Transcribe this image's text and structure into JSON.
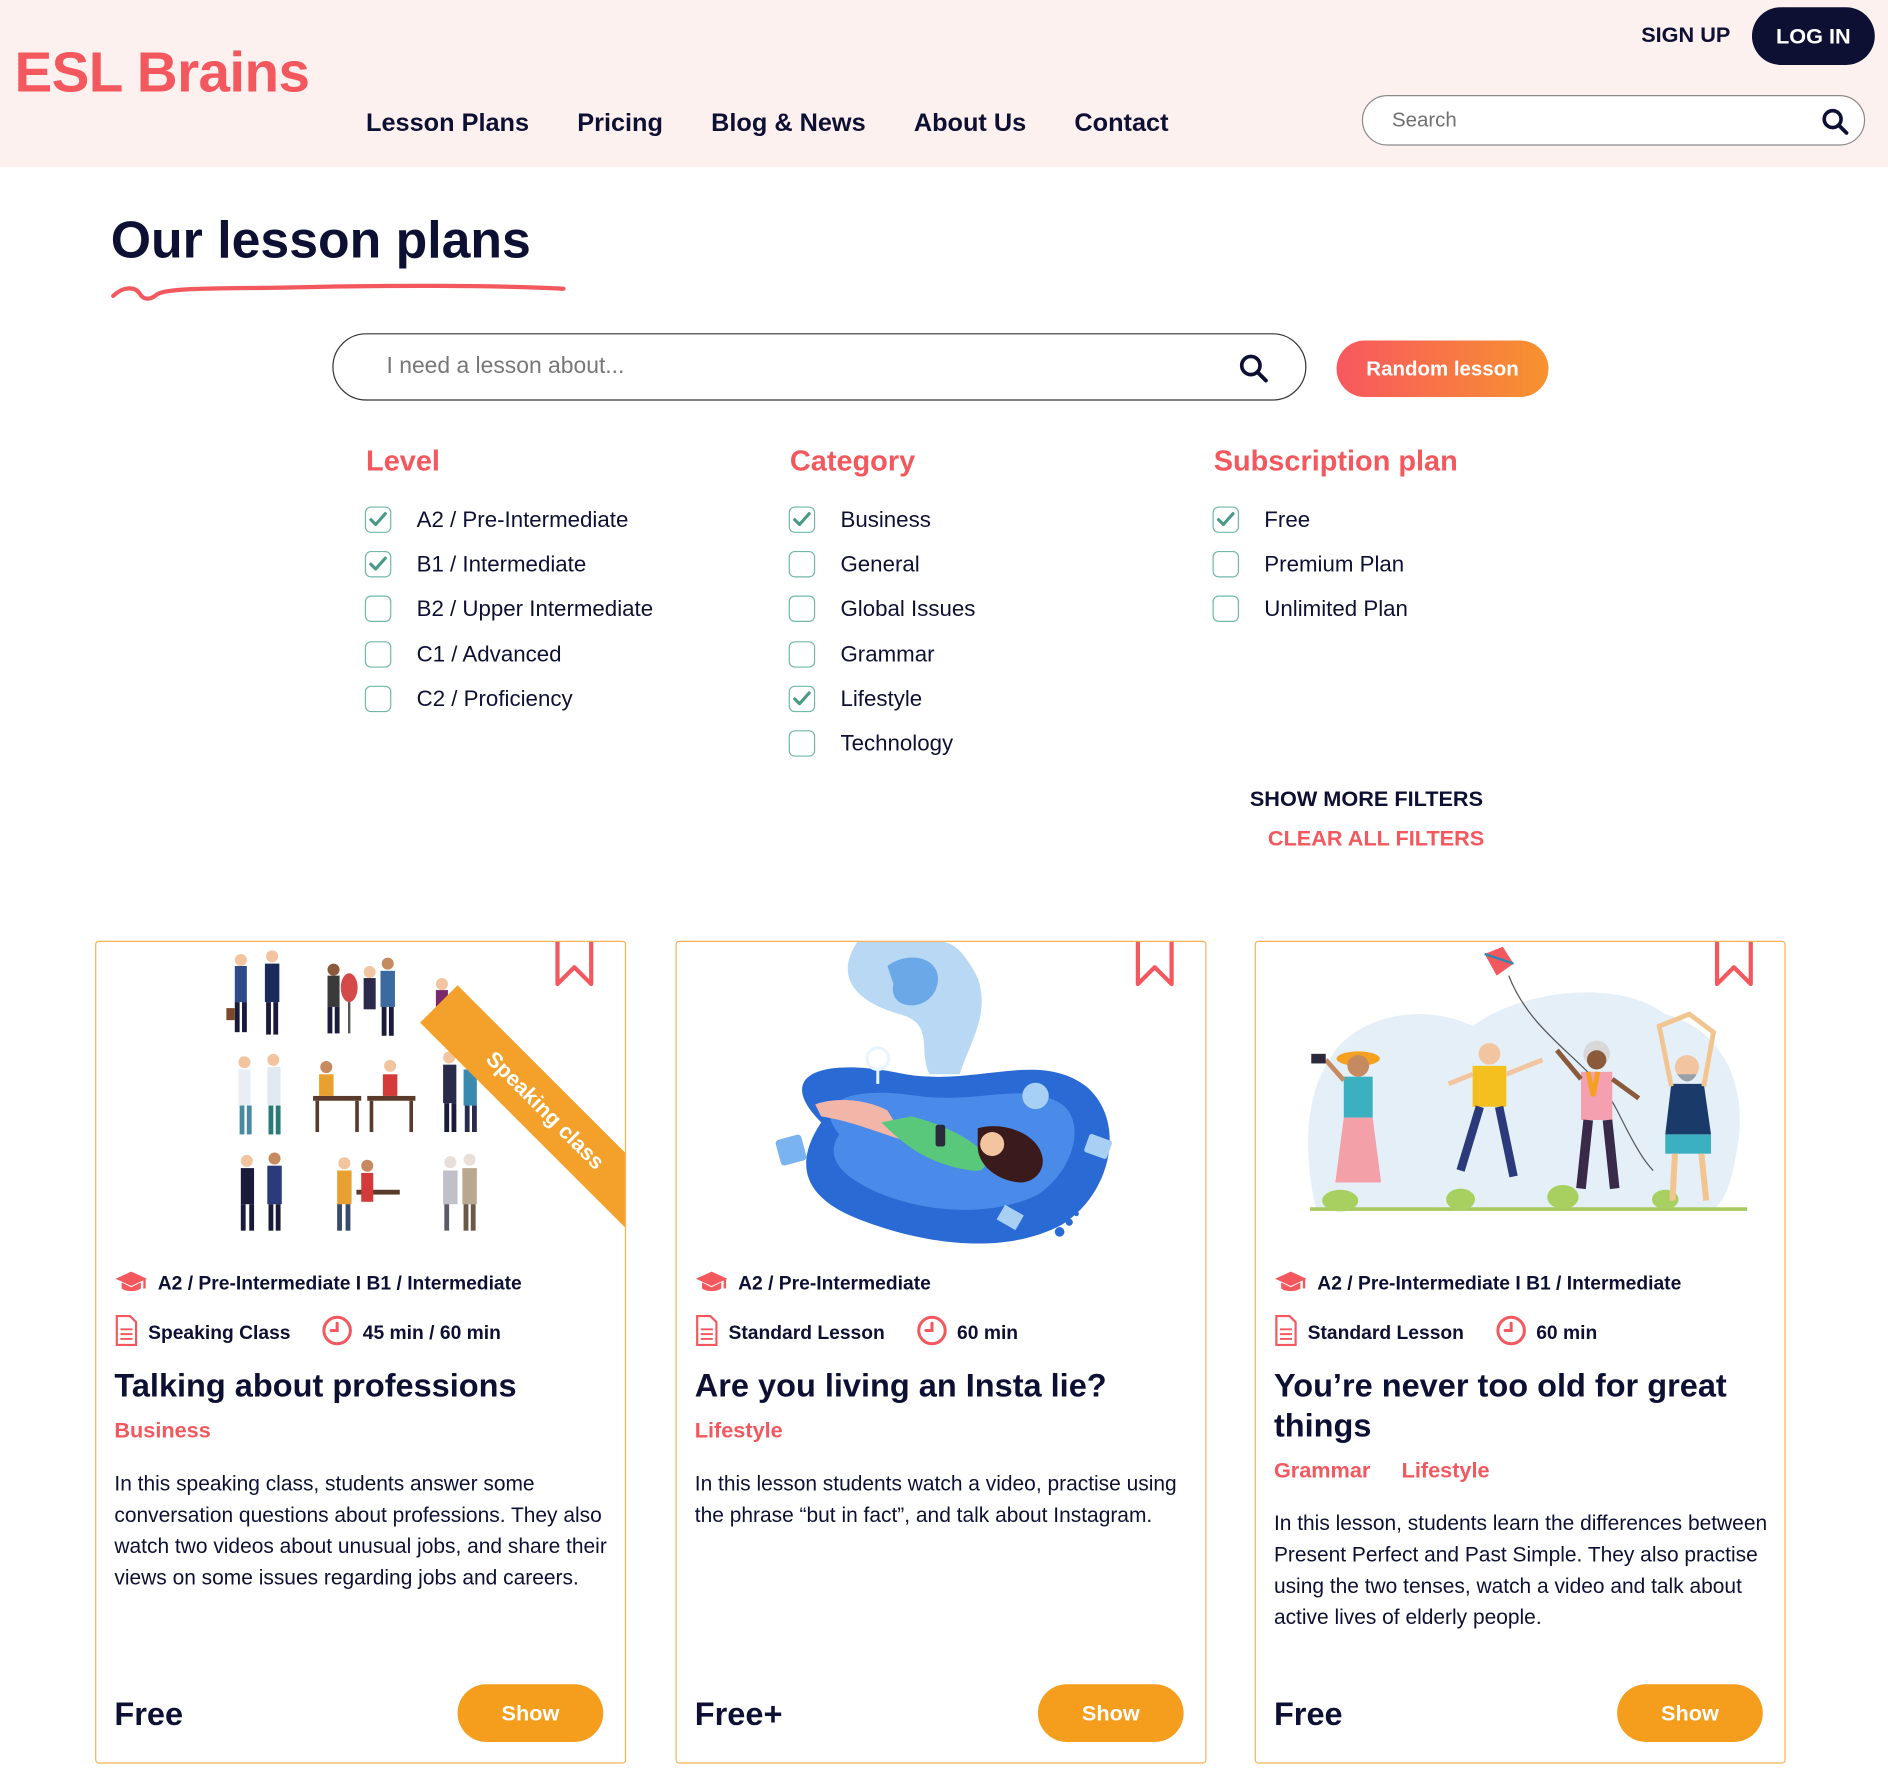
{
  "header": {
    "logo": "ESL Brains",
    "nav": [
      "Lesson Plans",
      "Pricing",
      "Blog & News",
      "About Us",
      "Contact"
    ],
    "sign_up": "SIGN UP",
    "log_in": "LOG IN",
    "search_placeholder": "Search"
  },
  "page": {
    "title": "Our lesson plans",
    "search_placeholder": "I need a lesson about...",
    "random_label": "Random lesson"
  },
  "filters": {
    "level": {
      "heading": "Level",
      "options": [
        {
          "label": "A2 / Pre-Intermediate",
          "checked": true
        },
        {
          "label": "B1 / Intermediate",
          "checked": true
        },
        {
          "label": "B2 / Upper Intermediate",
          "checked": false
        },
        {
          "label": "C1 / Advanced",
          "checked": false
        },
        {
          "label": "C2 / Proficiency",
          "checked": false
        }
      ]
    },
    "category": {
      "heading": "Category",
      "options": [
        {
          "label": "Business",
          "checked": true
        },
        {
          "label": "General",
          "checked": false
        },
        {
          "label": "Global Issues",
          "checked": false
        },
        {
          "label": "Grammar",
          "checked": false
        },
        {
          "label": "Lifestyle",
          "checked": true
        },
        {
          "label": "Technology",
          "checked": false
        }
      ]
    },
    "plan": {
      "heading": "Subscription plan",
      "options": [
        {
          "label": "Free",
          "checked": true
        },
        {
          "label": "Premium Plan",
          "checked": false
        },
        {
          "label": "Unlimited Plan",
          "checked": false
        }
      ]
    },
    "show_more": "SHOW MORE FILTERS",
    "clear_all": "CLEAR ALL FILTERS"
  },
  "cards": [
    {
      "ribbon": "Speaking class",
      "levels": "A2 / Pre-Intermediate I B1 / Intermediate",
      "type": "Speaking Class",
      "duration": "45 min / 60 min",
      "title": "Talking about professions",
      "categories": [
        "Business"
      ],
      "description": "In this speaking class, students answer some conversation questions about professions. They also watch two videos about unusual jobs, and share their views on some issues regarding jobs and careers.",
      "price": "Free",
      "button": "Show"
    },
    {
      "levels": "A2 / Pre-Intermediate",
      "type": "Standard Lesson",
      "duration": "60 min",
      "title": "Are you living an Insta lie?",
      "categories": [
        "Lifestyle"
      ],
      "description": "In this lesson students watch a video, practise using the phrase “but in fact”, and talk about Instagram.",
      "price": "Free+",
      "button": "Show"
    },
    {
      "levels": "A2 / Pre-Intermediate I B1 / Intermediate",
      "type": "Standard Lesson",
      "duration": "60 min",
      "title": "You’re never too old for great things",
      "categories": [
        "Grammar",
        "Lifestyle"
      ],
      "description": "In this lesson, students learn the differences between Present Perfect and Past Simple. They also practise using the two tenses, watch a video and talk about active lives of elderly people.",
      "price": "Free",
      "button": "Show"
    }
  ],
  "colors": {
    "brand": "#f2585e",
    "navy": "#0d1033",
    "orange": "#f59d1c",
    "check": "#6fb9a9",
    "header_bg": "#fdf1f0"
  },
  "icons": [
    "search-icon",
    "checkmark-icon",
    "bookmark-icon",
    "graduation-cap-icon",
    "document-icon",
    "clock-icon"
  ]
}
